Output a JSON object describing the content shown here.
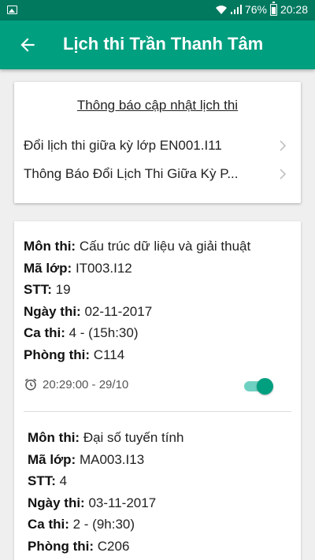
{
  "status_bar": {
    "battery": "76%",
    "time": "20:28"
  },
  "app_bar": {
    "title": "Lịch thi Trần Thanh Tâm"
  },
  "notices": {
    "title": "Thông báo cập nhật lịch thi",
    "items": [
      {
        "label": "Đổi lịch thi giữa kỳ lớp EN001.I11"
      },
      {
        "label": "Thông Báo Đổi Lịch Thi Giữa Kỳ P..."
      }
    ]
  },
  "labels": {
    "subject": "Môn thi:",
    "class_code": "Mã lớp:",
    "seq": "STT:",
    "date": "Ngày thi:",
    "shift": "Ca thi:",
    "room": "Phòng thi:"
  },
  "exams": [
    {
      "subject": "Cấu trúc dữ liệu và giải thuật",
      "class_code": "IT003.I12",
      "seq": "19",
      "date": "02-11-2017",
      "shift": "4 - (15h:30)",
      "room": "C114",
      "reminder": "20:29:00 - 29/10",
      "reminder_on": true
    },
    {
      "subject": "Đại số tuyến tính",
      "class_code": "MA003.I13",
      "seq": "4",
      "date": "03-11-2017",
      "shift": "2 - (9h:30)",
      "room": "C206"
    }
  ],
  "colors": {
    "primary": "#009f80",
    "primary_dark": "#00795f",
    "toggle_track": "#6fd1c1"
  },
  "icons": [
    "image-icon",
    "wifi-icon",
    "signal-icon",
    "battery-icon",
    "back-arrow-icon",
    "chevron-right-icon",
    "alarm-clock-icon"
  ]
}
